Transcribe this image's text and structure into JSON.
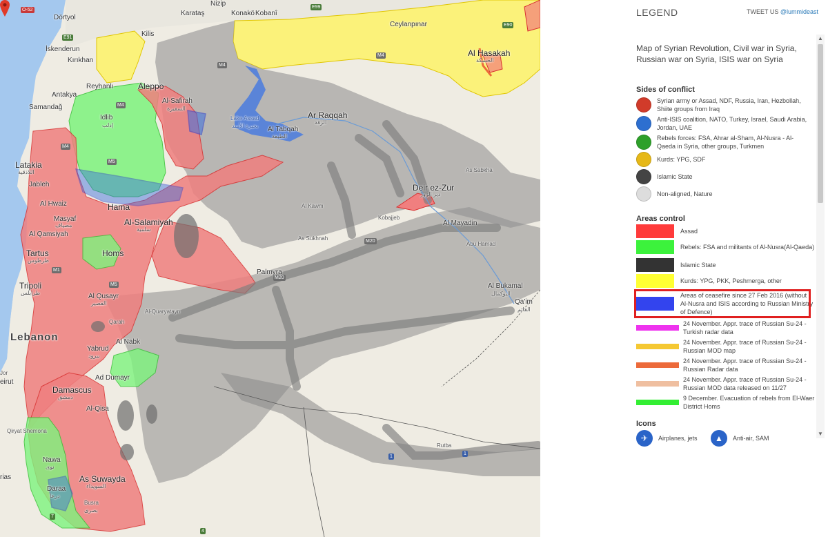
{
  "map": {
    "labels": {
      "dortyol": "Dörtyol",
      "karatas": "Karataş",
      "nizip": "Nizip",
      "konako": "Konakö",
      "kobani": "Kobanî",
      "ceylanpinar": "Ceylanpınar",
      "kilis": "Kilis",
      "iskenderun": "İskenderun",
      "kirikhan": "Kırıkhan",
      "reyhanli": "Reyhanlı",
      "aleppo": "Aleppo",
      "antakya": "Antakya",
      "samandag": "Samandağ",
      "al_safirah": "Al-Safirah",
      "al_safirah_ar": "السفيرة",
      "idlib": "Idlib",
      "idlib_ar": "إدلب",
      "lake_assad": "Lake Assad",
      "lake_assad_ar": "بحيرة الأسد",
      "al_tabqah": "Al Tabqah",
      "al_tabqah_ar": "الطبقة",
      "ar_raqqah": "Ar Raqqah",
      "ar_raqqah_ar": "الرقة",
      "al_hasakah": "Al Hasakah",
      "al_hasakah_ar": "الحسكة",
      "latakia": "Latakia",
      "latakia_ar": "اللاذقية",
      "jableh": "Jableh",
      "al_hwaiz": "Al Hwaiz",
      "hama": "Hama",
      "al_salamiyah": "Al-Salamiyah",
      "al_salamiyah_ar": "سلمية",
      "masyaf": "Masyaf",
      "masyaf_ar": "مصياف",
      "al_qamsiyah": "Al Qamsiyah",
      "tartus": "Tartus",
      "tartus_ar": "طرطوس",
      "homs": "Homs",
      "tripoli": "Tripoli",
      "tripoli_ar": "طرابلس",
      "lebanon": "Lebanon",
      "al_qusayr": "Al Qusayr",
      "al_qusayr_ar": "القصير",
      "qarah": "Qarah",
      "al_nabk": "Al Nabk",
      "yabrud": "Yabrud",
      "yabrud_ar": "يبرود",
      "al_qaryatayn": "Al-Quaryatayn",
      "ad_dumayr": "Ad Dumayr",
      "damascus": "Damascus",
      "damascus_ar": "دمشق",
      "al_qisa": "Al-Qisa",
      "qiryat_shemona": "Qiryat Shemona",
      "nawa": "Nawa",
      "nawa_ar": "نوى",
      "daraa": "Daraa",
      "daraa_ar": "درعا",
      "as_suwayda": "As Suwayda",
      "as_suwayda_ar": "السويداء",
      "busra": "Busra",
      "busra_ar": "بصرى",
      "palmyra": "Palmyra",
      "as_sukhnah": "As Sukhnah",
      "al_kawm": "Al Kawm",
      "deir_ez_zur": "Deir ez-Zur",
      "deir_ez_zur_ar": "دير الزور",
      "al_mayadin": "Al Mayadin",
      "abu_hamad": "Abu Hamad",
      "kobajjeb": "Kobajjeb",
      "al_bukamal": "Al Bukamal",
      "al_bukamal_ar": "البوكمال",
      "qaim": "Qa'im",
      "qaim_ar": "القائم",
      "as_sabkha": "As Sabkha",
      "rutba": "Rutba",
      "beirut": "eirut",
      "rias": "rias",
      "jor": "Jor"
    },
    "shields": {
      "e91": "E91",
      "e99": "E99",
      "e90": "E90",
      "o52": "O-52",
      "m4a": "M4",
      "m4b": "M4",
      "m4c": "M4",
      "m4d": "M4",
      "m5a": "M5",
      "m5b": "M5",
      "m1": "M1",
      "m20": "M20",
      "m20b": "M20",
      "e1": "1",
      "e2": "1",
      "h7": "7",
      "h4": "4"
    }
  },
  "legend": {
    "title": "LEGEND",
    "tweet_prefix": "TWEET US ",
    "tweet_handle": "@lummideast",
    "description": "Map of Syrian Revolution, Civil war in Syria, Russian war on Syria, ISIS war on Syria",
    "sides_title": "Sides of conflict",
    "sides": [
      {
        "color": "#d13b2a",
        "text": "Syrian army or Assad, NDF, Russia, Iran, Hezbollah, Shiite groups from Iraq"
      },
      {
        "color": "#2d6fd0",
        "text": "Anti-ISIS coalition, NATO, Turkey, Israel, Saudi Arabia, Jordan, UAE"
      },
      {
        "color": "#2ea02a",
        "text": "Rebels forces: FSA, Ahrar al-Sham, Al-Nusra - Al-Qaeda in Syria, other groups, Turkmen"
      },
      {
        "color": "#e6b818",
        "text": "Kurds: YPG, SDF"
      },
      {
        "color": "#444444",
        "text": "Islamic State"
      },
      {
        "color": "#dddddd",
        "text": "Non-aligned, Nature"
      }
    ],
    "areas_title": "Areas control",
    "areas": [
      {
        "color": "#ff3b3b",
        "text": "Assad"
      },
      {
        "color": "#3cf23c",
        "text": "Rebels: FSA and militants of Al-Nusra(Al-Qaeda)"
      },
      {
        "color": "#333333",
        "text": "Islamic State"
      },
      {
        "color": "#ffff33",
        "text": "Kurds: YPG, PKK, Peshmerga, other"
      },
      {
        "color": "#3344ee",
        "text": "Areas of ceasefire since 27 Feb 2016 (without Al-Nusra and ISIS according to Russian Ministry of Defence)"
      }
    ],
    "traces": [
      {
        "color": "#ee33ee",
        "text": "24 November. Appr. trace of Russian Su-24 - Turkish radar data"
      },
      {
        "color": "#f5c832",
        "text": "24 November. Appr. trace of Russian Su-24 - Russian MOD map"
      },
      {
        "color": "#ec6a3a",
        "text": "24 November. Appr. trace of Russian Su-24 - Russian Radar data"
      },
      {
        "color": "#efbfa0",
        "text": "24 November. Appr. trace of Russian Su-24 - Russian MOD data released on 11/27"
      },
      {
        "color": "#33ee33",
        "text": "9 December. Evacuation of rebels from El-Waer District Homs"
      }
    ],
    "icons_title": "Icons",
    "icons": [
      {
        "glyph": "✈",
        "text": "Airplanes, jets"
      },
      {
        "glyph": "▲",
        "text": "Anti-air, SAM"
      }
    ]
  },
  "scrollbar": {
    "up": "▲",
    "down": "▼"
  }
}
